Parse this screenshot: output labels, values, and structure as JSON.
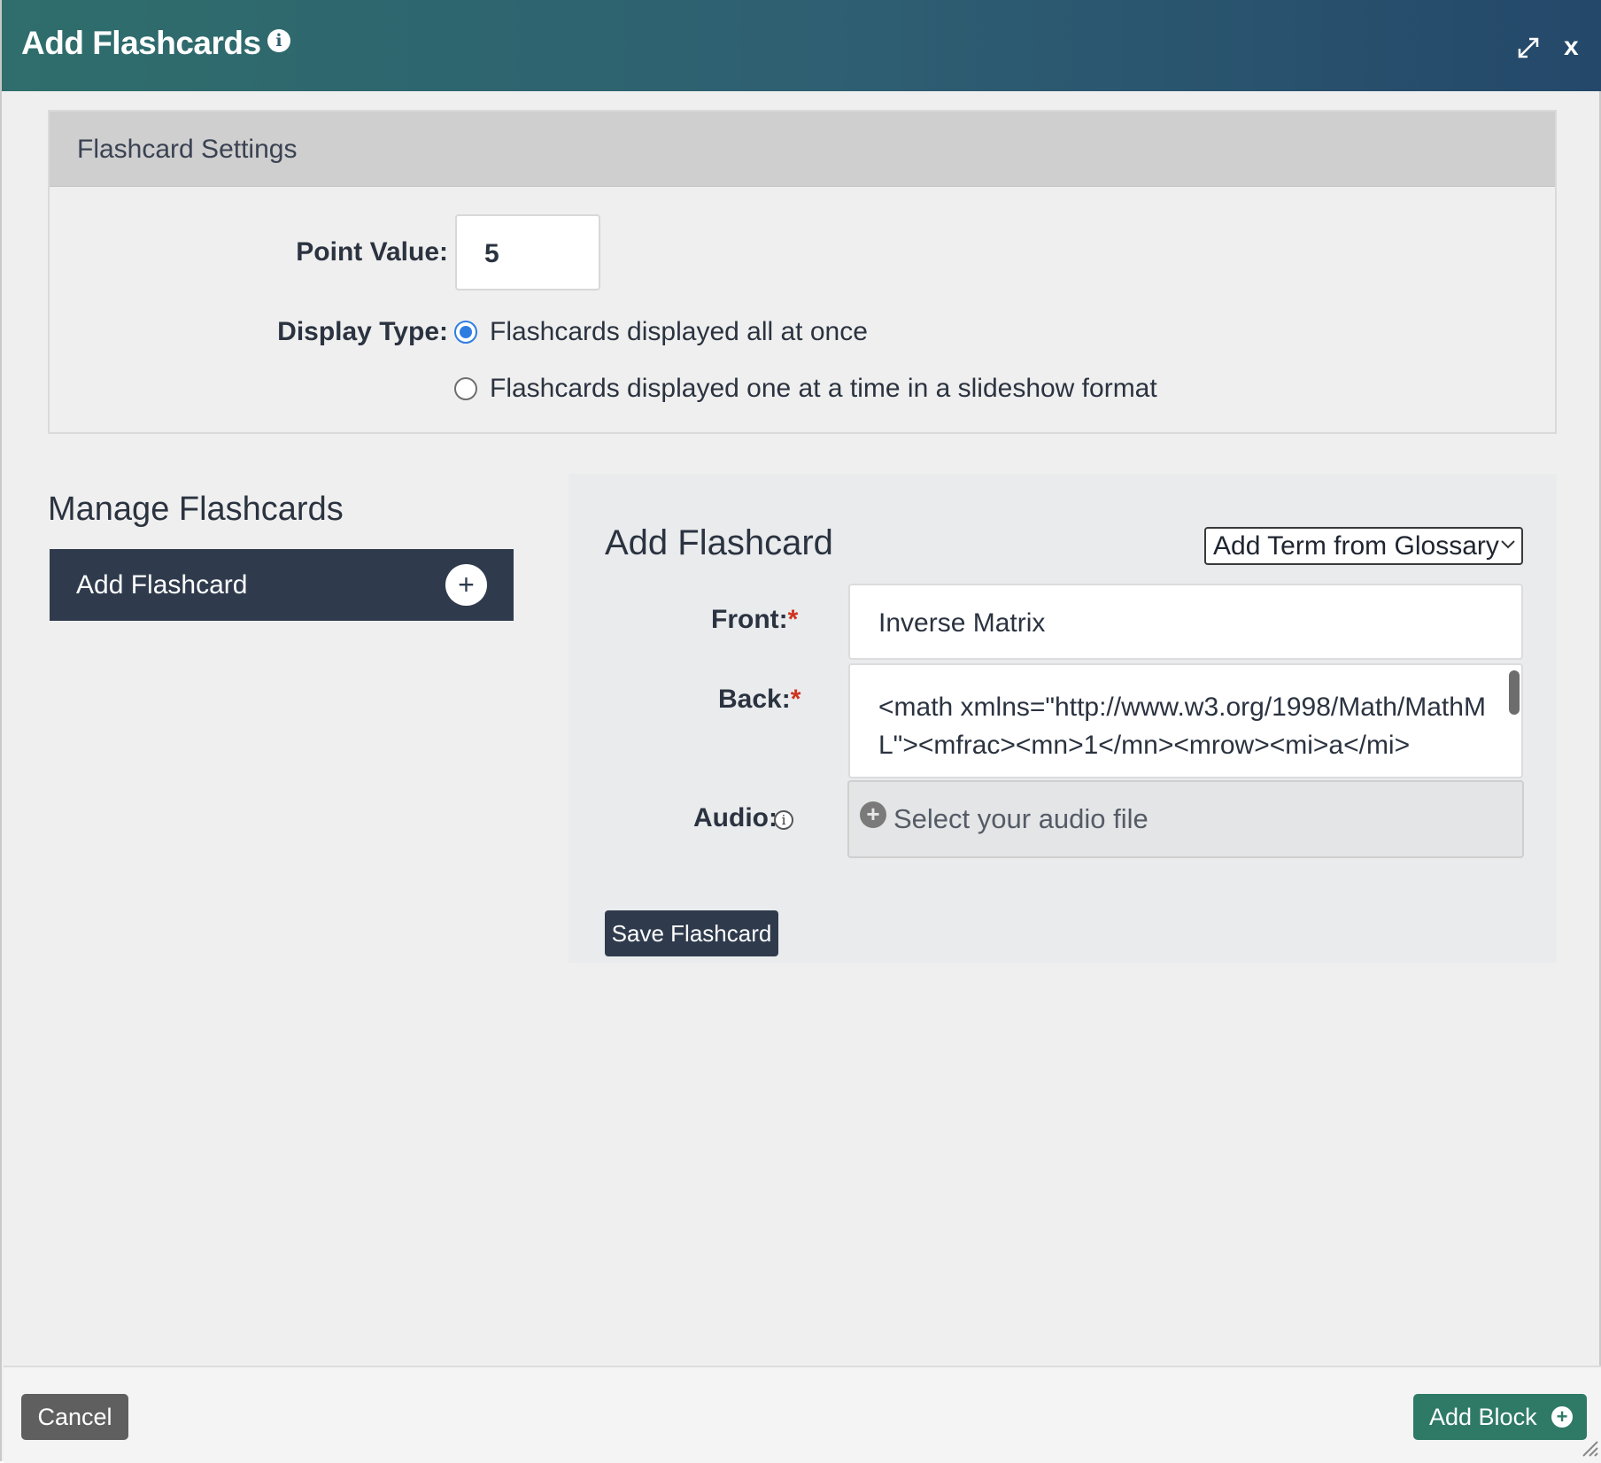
{
  "dialog": {
    "title": "Add Flashcards",
    "info_icon": "i",
    "close_label": "x",
    "header_colors": [
      "#2f6e6c",
      "#24486a"
    ]
  },
  "settings": {
    "title": "Flashcard Settings",
    "point_value_label": "Point Value:",
    "point_value": "5",
    "display_type_label": "Display Type:",
    "display_options": [
      {
        "label": "Flashcards displayed all at once",
        "checked": true
      },
      {
        "label": "Flashcards displayed one at a time in a slideshow format",
        "checked": false
      }
    ]
  },
  "manage": {
    "title": "Manage Flashcards",
    "add_item_label": "Add Flashcard",
    "add_icon": "+"
  },
  "form": {
    "title": "Add Flashcard",
    "glossary_select": "Add Term from Glossary",
    "front_label": "Front:",
    "front_value": "Inverse Matrix",
    "back_label": "Back:",
    "back_value": "<math xmlns=\"http://www.w3.org/1998/Math/MathML\"><mfrac><mn>1</mn><mrow><mi>a</mi>",
    "audio_label": "Audio:",
    "audio_placeholder": "Select your audio file",
    "required_mark": "*",
    "save_label": "Save Flashcard"
  },
  "footer": {
    "cancel_label": "Cancel",
    "add_block_label": "Add Block"
  },
  "colors": {
    "dark_button": "#2f3b4d",
    "accent_green": "#2e7a67",
    "required_red": "#d0331f",
    "radio_blue": "#2f7de1"
  }
}
